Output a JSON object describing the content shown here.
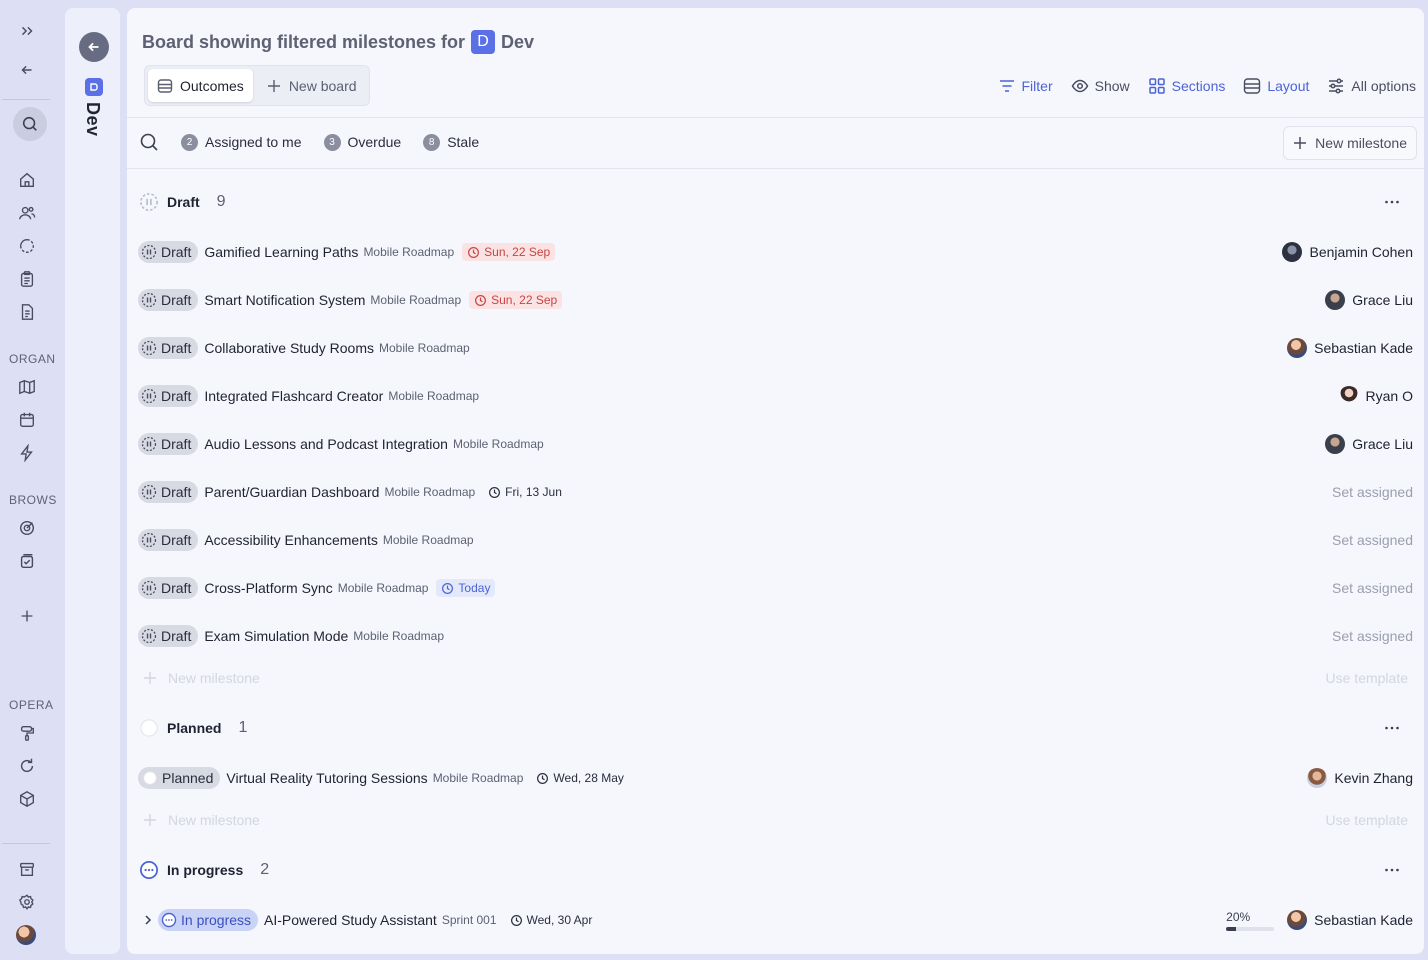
{
  "rail": {
    "labels": [
      "ORGAN",
      "BROWS",
      "OPERA"
    ]
  },
  "space": {
    "badge_letter": "D",
    "name": "Dev"
  },
  "header": {
    "title_prefix": "Board showing filtered milestones for",
    "space_letter": "D",
    "space_name": "Dev"
  },
  "tabs": [
    {
      "label": "Outcomes",
      "active": true
    },
    {
      "label": "New board",
      "active": false
    }
  ],
  "toolbar": {
    "filter": "Filter",
    "show": "Show",
    "sections": "Sections",
    "layout": "Layout",
    "all_options": "All options"
  },
  "quick_filters": [
    {
      "count": "2",
      "label": "Assigned to me"
    },
    {
      "count": "3",
      "label": "Overdue"
    },
    {
      "count": "8",
      "label": "Stale"
    }
  ],
  "new_milestone_button": "New milestone",
  "sections": [
    {
      "name": "Draft",
      "count": "9",
      "rows": [
        {
          "status": "Draft",
          "title": "Gamified Learning Paths",
          "project": "Mobile Roadmap",
          "date": "Sun, 22 Sep",
          "date_kind": "overdue",
          "assignee": "Benjamin Cohen"
        },
        {
          "status": "Draft",
          "title": "Smart Notification System",
          "project": "Mobile Roadmap",
          "date": "Sun, 22 Sep",
          "date_kind": "overdue",
          "assignee": "Grace Liu"
        },
        {
          "status": "Draft",
          "title": "Collaborative Study Rooms",
          "project": "Mobile Roadmap",
          "date": "",
          "date_kind": "none",
          "assignee": "Sebastian Kade"
        },
        {
          "status": "Draft",
          "title": "Integrated Flashcard Creator",
          "project": "Mobile Roadmap",
          "date": "",
          "date_kind": "none",
          "assignee": "Ryan O"
        },
        {
          "status": "Draft",
          "title": "Audio Lessons and Podcast Integration",
          "project": "Mobile Roadmap",
          "date": "",
          "date_kind": "none",
          "assignee": "Grace Liu"
        },
        {
          "status": "Draft",
          "title": "Parent/Guardian Dashboard",
          "project": "Mobile Roadmap",
          "date": "Fri, 13 Jun",
          "date_kind": "normal",
          "assignee": ""
        },
        {
          "status": "Draft",
          "title": "Accessibility Enhancements",
          "project": "Mobile Roadmap",
          "date": "",
          "date_kind": "none",
          "assignee": ""
        },
        {
          "status": "Draft",
          "title": "Cross-Platform Sync",
          "project": "Mobile Roadmap",
          "date": "Today",
          "date_kind": "today",
          "assignee": ""
        },
        {
          "status": "Draft",
          "title": "Exam Simulation Mode",
          "project": "Mobile Roadmap",
          "date": "",
          "date_kind": "none",
          "assignee": ""
        }
      ],
      "new_label": "New milestone",
      "template_label": "Use template"
    },
    {
      "name": "Planned",
      "count": "1",
      "rows": [
        {
          "status": "Planned",
          "title": "Virtual Reality Tutoring Sessions",
          "project": "Mobile Roadmap",
          "date": "Wed, 28 May",
          "date_kind": "normal",
          "assignee": "Kevin Zhang"
        }
      ],
      "new_label": "New milestone",
      "template_label": "Use template"
    },
    {
      "name": "In progress",
      "count": "2",
      "rows": [
        {
          "status": "In progress",
          "title": "AI-Powered Study Assistant",
          "project": "Sprint 001",
          "date": "Wed, 30 Apr",
          "date_kind": "normal",
          "progress": "20%",
          "progress_value": 0.2,
          "assignee": "Sebastian Kade"
        }
      ]
    }
  ],
  "set_assigned_label": "Set assigned",
  "colors": {
    "accent": "#4b63d6",
    "space_badge": "#5b6fe6",
    "overdue": "#c84444",
    "overdue_bg": "#fbe3e3"
  }
}
